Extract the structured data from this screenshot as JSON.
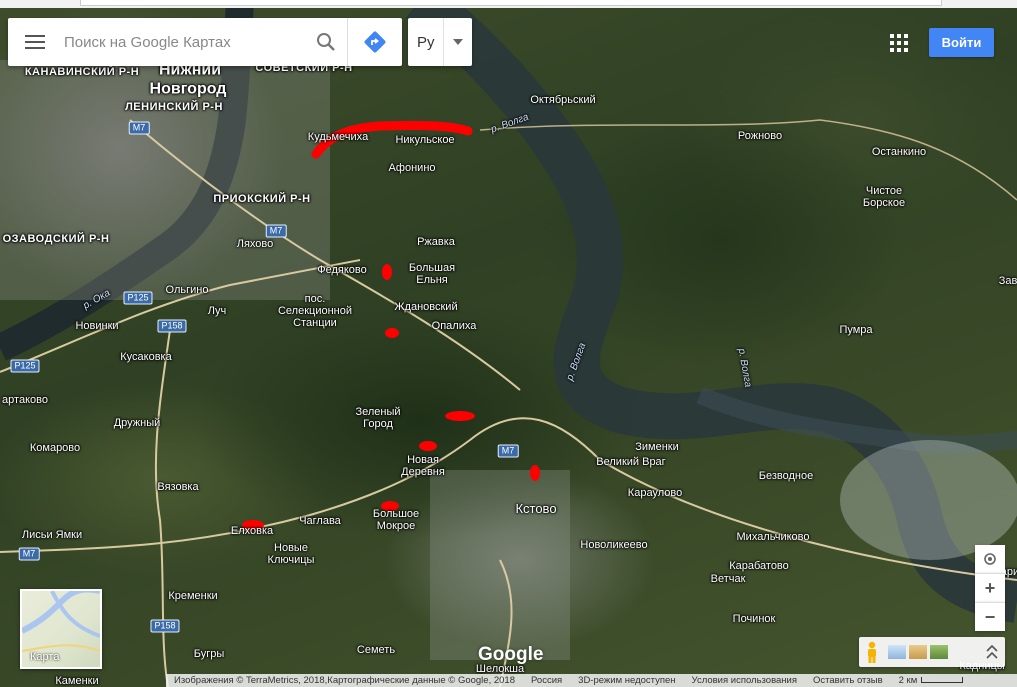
{
  "search": {
    "placeholder": "Поиск на Google Картах"
  },
  "language": {
    "value": "Ру"
  },
  "signin_label": "Войти",
  "minimap_label": "Карта",
  "logo": "Google",
  "icons": {
    "menu": "menu-icon",
    "search": "search-icon",
    "directions": "directions-icon",
    "dropdown": "chevron-down-icon",
    "apps": "apps-grid-icon",
    "location": "my-location-icon",
    "zoom_in": "plus-icon",
    "zoom_out": "minus-icon",
    "pegman": "pegman-icon",
    "expand": "expand-icon"
  },
  "zoom": {
    "in": "+",
    "out": "−"
  },
  "footer": {
    "attribution": "Изображения © TerraMetrics, 2018,Картографические данные © Google, 2018",
    "country": "Россия",
    "mode_3d": "3D-режим недоступен",
    "terms": "Условия использования",
    "feedback": "Оставить отзыв",
    "scale": "2 км"
  },
  "colors": {
    "accent": "#4285f4",
    "marker": "#ff0000",
    "river": "#2e3b3c",
    "road": "#d9c9a0"
  },
  "labels": {
    "nn_line1": "Нижний",
    "nn_line2": "Новгород",
    "kanavinsky": "КАНАВИНСКИЙ Р-Н",
    "sovetsky": "СОВЕТСКИЙ Р-Н",
    "leninsky": "ЛЕНИНСКИЙ Р-Н",
    "priok": "ПРИОКСКИЙ Р-Н",
    "avtozavod": "ОЗАВОДСКИЙ Р-Н",
    "oktyabr": "Октябрьский",
    "kudma": "Кудьмечиха",
    "nikulskoe": "Никульское",
    "afonino": "Афонино",
    "rzhavka": "Ржавка",
    "lyakhovo": "Ляхово",
    "fedyakovo": "Федяково",
    "bolshaya_elnya": "Большая\nЕльня",
    "zhdanovsky": "Ждановский",
    "opalikha": "Опалиха",
    "selekts": "пос.\nСелекционной\nСтанции",
    "olgino": "Ольгино",
    "luch": "Луч",
    "novinki": "Новинки",
    "kusakovka": "Кусаковка",
    "artakovo": "артаково",
    "druzhny": "Дружный",
    "zeleny": "Зеленый\nГород",
    "komarovo": "Комарово",
    "vyazovka": "Вязовка",
    "novaya_derevnya": "Новая\nДеревня",
    "lisi": "Лисьи Ямки",
    "elkhovka": "Елховка",
    "chaglava": "Чаглава",
    "bolshoe_mokroe": "Большое\nМокрое",
    "novye_klyuchitsy": "Новые\nКлючицы",
    "kremenki": "Кременки",
    "semet": "Семеть",
    "bugry": "Бугры",
    "kamenki": "Каменки",
    "kstovo": "Кстово",
    "zimenki": "Зименки",
    "veliky_vrag": "Великий Враг",
    "karaulovo": "Караулово",
    "bezvodnoe": "Безводное",
    "novolikeevo": "Новоликеево",
    "vetchak": "Ветчак",
    "mikhalchikovo": "Михальчиково",
    "karabatovo": "Карабатово",
    "pochinok": "Починок",
    "rozhnovo": "Рожново",
    "ostankino": "Останкино",
    "chistoe_borskoe": "Чистое\nБорское",
    "pumra": "Пумра",
    "zav": "Зав",
    "shelokha": "Шелокша",
    "parishi": "Пари",
    "kadnitsy": "Кадницы",
    "volga1": "р. Волга",
    "volga2": "р. Волга",
    "volga3": "р. Волга",
    "oka": "р. Ока"
  },
  "shields": {
    "m7a": "M7",
    "m7b": "M7",
    "m7c": "M7",
    "m7d": "M7",
    "p125a": "P125",
    "p125b": "P125",
    "p158a": "P158",
    "p158b": "P158"
  }
}
